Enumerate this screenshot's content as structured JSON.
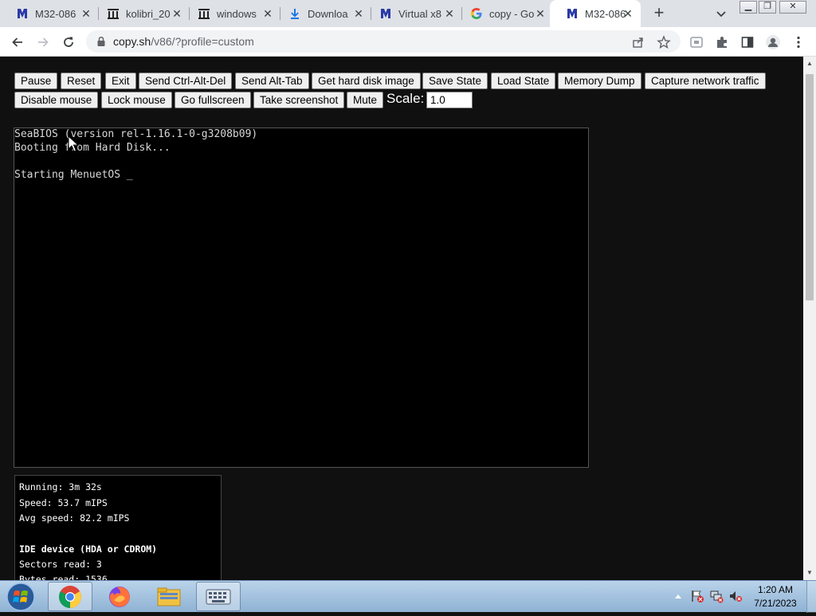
{
  "tabs": [
    {
      "label": "M32-086",
      "icon": "v86-icon"
    },
    {
      "label": "kolibri_20",
      "icon": "archive-icon"
    },
    {
      "label": "windows",
      "icon": "archive-icon"
    },
    {
      "label": "Downloa",
      "icon": "download-icon"
    },
    {
      "label": "Virtual x8",
      "icon": "v86-icon"
    },
    {
      "label": "copy - Go",
      "icon": "google-icon"
    },
    {
      "label": "M32-086",
      "icon": "v86-icon",
      "active": true
    }
  ],
  "address_bar": {
    "host": "copy.sh",
    "path": "/v86/?profile=custom"
  },
  "controls": {
    "row1": [
      "Pause",
      "Reset",
      "Exit",
      "Send Ctrl-Alt-Del",
      "Send Alt-Tab",
      "Get hard disk image",
      "Save State",
      "Load State",
      "Memory Dump",
      "Capture network traffic"
    ],
    "row2": [
      "Disable mouse",
      "Lock mouse",
      "Go fullscreen",
      "Take screenshot",
      "Mute"
    ],
    "scale_label": "Scale:",
    "scale_value": "1.0"
  },
  "screen_lines": [
    "SeaBIOS (version rel-1.16.1-0-g3208b09)",
    "Booting from Hard Disk...",
    "",
    "Starting MenuetOS _"
  ],
  "stats": {
    "running": "Running: 3m 32s",
    "speed": "Speed: 53.7 mIPS",
    "avg_speed": "Avg speed: 82.2 mIPS",
    "ide_title": "IDE device (HDA or CDROM)",
    "sectors_read": "Sectors read: 3",
    "bytes_read": "Bytes read: 1536"
  },
  "taskbar": {
    "apps": [
      "chrome-icon",
      "firefox-icon",
      "file-explorer-icon",
      "keyboard-icon"
    ],
    "time": "1:20 AM",
    "date": "7/21/2023"
  },
  "colors": {
    "page_bg": "#101010",
    "tab_strip": "#dee1e6",
    "taskbar": "#a6c2e0"
  }
}
